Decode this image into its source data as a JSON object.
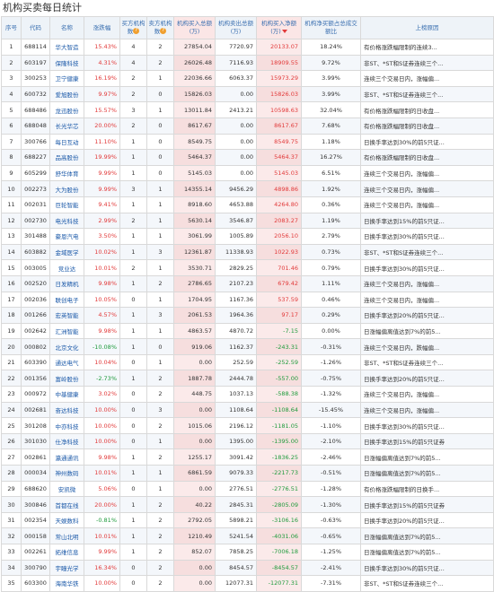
{
  "page": {
    "title": "机构买卖每日统计"
  },
  "columns": [
    {
      "key": "seq",
      "label": "序号"
    },
    {
      "key": "code",
      "label": "代码"
    },
    {
      "key": "name",
      "label": "名称"
    },
    {
      "key": "change",
      "label": "涨跌幅"
    },
    {
      "key": "buyers",
      "label": "买方机构数"
    },
    {
      "key": "sellers",
      "label": "卖方机构数"
    },
    {
      "key": "buy",
      "label": "机构买入总额(万)"
    },
    {
      "key": "sell",
      "label": "机构卖出总额(万)"
    },
    {
      "key": "net",
      "label": "机构买入净额(万)"
    },
    {
      "key": "ratio",
      "label": "机构净买额占总成交额比"
    },
    {
      "key": "reason",
      "label": "上榜原因"
    }
  ],
  "rows": [
    {
      "seq": "1",
      "code": "688114",
      "name": "华大智造",
      "change": "15.43%",
      "buyers": "4",
      "sellers": "2",
      "buy": "27854.04",
      "sell": "7720.97",
      "net": "20133.07",
      "ratio": "18.24%",
      "reason": "有价格涨跌幅限制的连续3..."
    },
    {
      "seq": "2",
      "code": "603197",
      "name": "保隆科技",
      "change": "4.31%",
      "buyers": "4",
      "sellers": "2",
      "buy": "26026.48",
      "sell": "7116.93",
      "net": "18909.55",
      "ratio": "9.72%",
      "reason": "非ST、*ST和S证券连续三个..."
    },
    {
      "seq": "3",
      "code": "300253",
      "name": "卫宁健康",
      "change": "16.19%",
      "buyers": "2",
      "sellers": "1",
      "buy": "22036.66",
      "sell": "6063.37",
      "net": "15973.29",
      "ratio": "3.99%",
      "reason": "连续三个交易日内，涨幅偏..."
    },
    {
      "seq": "4",
      "code": "600732",
      "name": "爱旭股份",
      "change": "9.97%",
      "buyers": "2",
      "sellers": "0",
      "buy": "15826.03",
      "sell": "0.00",
      "net": "15826.03",
      "ratio": "3.99%",
      "reason": "非ST、*ST和S证券连续三个..."
    },
    {
      "seq": "5",
      "code": "688486",
      "name": "龙迅股份",
      "change": "15.57%",
      "buyers": "3",
      "sellers": "1",
      "buy": "13011.84",
      "sell": "2413.21",
      "net": "10598.63",
      "ratio": "32.04%",
      "reason": "有价格涨跌幅限制的日收盘..."
    },
    {
      "seq": "6",
      "code": "688048",
      "name": "长光华芯",
      "change": "20.00%",
      "buyers": "2",
      "sellers": "0",
      "buy": "8617.67",
      "sell": "0.00",
      "net": "8617.67",
      "ratio": "7.68%",
      "reason": "有价格涨跌幅限制的日收盘..."
    },
    {
      "seq": "7",
      "code": "300766",
      "name": "每日互动",
      "change": "11.10%",
      "buyers": "1",
      "sellers": "0",
      "buy": "8549.75",
      "sell": "0.00",
      "net": "8549.75",
      "ratio": "1.18%",
      "reason": "日换手率达到30%的前5只证..."
    },
    {
      "seq": "8",
      "code": "688227",
      "name": "品高股份",
      "change": "19.99%",
      "buyers": "1",
      "sellers": "0",
      "buy": "5464.37",
      "sell": "0.00",
      "net": "5464.37",
      "ratio": "16.27%",
      "reason": "有价格涨跌幅限制的日收盘..."
    },
    {
      "seq": "9",
      "code": "605299",
      "name": "舒华体育",
      "change": "9.99%",
      "buyers": "1",
      "sellers": "0",
      "buy": "5145.03",
      "sell": "0.00",
      "net": "5145.03",
      "ratio": "6.51%",
      "reason": "连续三个交易日内，涨幅偏..."
    },
    {
      "seq": "10",
      "code": "002273",
      "name": "大为股份",
      "change": "9.99%",
      "buyers": "3",
      "sellers": "1",
      "buy": "14355.14",
      "sell": "9456.29",
      "net": "4898.86",
      "ratio": "1.92%",
      "reason": "连续三个交易日内，涨幅偏..."
    },
    {
      "seq": "11",
      "code": "002031",
      "name": "巨轮智能",
      "change": "9.41%",
      "buyers": "1",
      "sellers": "1",
      "buy": "8918.60",
      "sell": "4653.88",
      "net": "4264.80",
      "ratio": "0.36%",
      "reason": "连续三个交易日内，涨幅偏..."
    },
    {
      "seq": "12",
      "code": "002730",
      "name": "电光科技",
      "change": "2.99%",
      "buyers": "2",
      "sellers": "1",
      "buy": "5630.14",
      "sell": "3546.87",
      "net": "2083.27",
      "ratio": "1.19%",
      "reason": "日换手率达到15%的前5只证..."
    },
    {
      "seq": "13",
      "code": "301488",
      "name": "豪恩汽电",
      "change": "3.50%",
      "buyers": "1",
      "sellers": "1",
      "buy": "3061.99",
      "sell": "1005.89",
      "net": "2056.10",
      "ratio": "2.79%",
      "reason": "日换手率达到30%的前5只证..."
    },
    {
      "seq": "14",
      "code": "603882",
      "name": "金域医学",
      "change": "10.02%",
      "buyers": "1",
      "sellers": "3",
      "buy": "12361.87",
      "sell": "11338.93",
      "net": "1022.93",
      "ratio": "0.73%",
      "reason": "非ST、*ST和S证券连续三个..."
    },
    {
      "seq": "15",
      "code": "003005",
      "name": "竞业达",
      "change": "10.01%",
      "buyers": "2",
      "sellers": "1",
      "buy": "3530.71",
      "sell": "2829.25",
      "net": "701.46",
      "ratio": "0.79%",
      "reason": "日换手率达到30%的前5只证..."
    },
    {
      "seq": "16",
      "code": "002520",
      "name": "日发精机",
      "change": "9.98%",
      "buyers": "1",
      "sellers": "2",
      "buy": "2786.65",
      "sell": "2107.23",
      "net": "679.42",
      "ratio": "1.11%",
      "reason": "连续三个交易日内，涨幅偏..."
    },
    {
      "seq": "17",
      "code": "002036",
      "name": "联创电子",
      "change": "10.05%",
      "buyers": "0",
      "sellers": "1",
      "buy": "1704.95",
      "sell": "1167.36",
      "net": "537.59",
      "ratio": "0.46%",
      "reason": "连续三个交易日内，涨幅偏..."
    },
    {
      "seq": "18",
      "code": "001266",
      "name": "宏英智能",
      "change": "4.57%",
      "buyers": "1",
      "sellers": "3",
      "buy": "2061.53",
      "sell": "1964.36",
      "net": "97.17",
      "ratio": "0.29%",
      "reason": "日换手率达到20%的前5只证..."
    },
    {
      "seq": "19",
      "code": "002642",
      "name": "汇洲智能",
      "change": "9.98%",
      "buyers": "1",
      "sellers": "1",
      "buy": "4863.57",
      "sell": "4870.72",
      "net": "-7.15",
      "ratio": "0.00%",
      "reason": "日涨幅偏离值达到7%的前5..."
    },
    {
      "seq": "20",
      "code": "000802",
      "name": "北京文化",
      "change": "-10.08%",
      "buyers": "1",
      "sellers": "0",
      "buy": "919.06",
      "sell": "1162.37",
      "net": "-243.31",
      "ratio": "-0.31%",
      "reason": "连续三个交易日内，跌幅偏..."
    },
    {
      "seq": "21",
      "code": "603390",
      "name": "通达电气",
      "change": "10.04%",
      "buyers": "0",
      "sellers": "1",
      "buy": "0.00",
      "sell": "252.59",
      "net": "-252.59",
      "ratio": "-1.26%",
      "reason": "非ST、*ST和S证券连续三个..."
    },
    {
      "seq": "22",
      "code": "001356",
      "name": "富岭股份",
      "change": "-2.73%",
      "buyers": "1",
      "sellers": "2",
      "buy": "1887.78",
      "sell": "2444.78",
      "net": "-557.00",
      "ratio": "-0.75%",
      "reason": "日换手率达到20%的前5只证..."
    },
    {
      "seq": "23",
      "code": "000972",
      "name": "中基健康",
      "change": "3.02%",
      "buyers": "0",
      "sellers": "2",
      "buy": "448.75",
      "sell": "1037.13",
      "net": "-588.38",
      "ratio": "-1.32%",
      "reason": "连续三个交易日内，涨幅偏..."
    },
    {
      "seq": "24",
      "code": "002681",
      "name": "奋达科技",
      "change": "10.00%",
      "buyers": "0",
      "sellers": "3",
      "buy": "0.00",
      "sell": "1108.64",
      "net": "-1108.64",
      "ratio": "-15.45%",
      "reason": "连续三个交易日内，涨幅偏..."
    },
    {
      "seq": "25",
      "code": "301208",
      "name": "中亦科技",
      "change": "10.00%",
      "buyers": "0",
      "sellers": "2",
      "buy": "1015.06",
      "sell": "2196.12",
      "net": "-1181.05",
      "ratio": "-1.10%",
      "reason": "日换手率达到30%的前5只证..."
    },
    {
      "seq": "26",
      "code": "301030",
      "name": "仕净科技",
      "change": "10.00%",
      "buyers": "0",
      "sellers": "1",
      "buy": "0.00",
      "sell": "1395.00",
      "net": "-1395.00",
      "ratio": "-2.10%",
      "reason": "日换手率达到15%的前5只证券"
    },
    {
      "seq": "27",
      "code": "002861",
      "name": "瀛通通讯",
      "change": "9.98%",
      "buyers": "1",
      "sellers": "2",
      "buy": "1255.17",
      "sell": "3091.42",
      "net": "-1836.25",
      "ratio": "-2.46%",
      "reason": "日涨幅偏离值达到7%的前5..."
    },
    {
      "seq": "28",
      "code": "000034",
      "name": "神州数码",
      "change": "10.01%",
      "buyers": "1",
      "sellers": "1",
      "buy": "6861.59",
      "sell": "9079.33",
      "net": "-2217.73",
      "ratio": "-0.51%",
      "reason": "日涨幅偏离值达到7%的前5..."
    },
    {
      "seq": "29",
      "code": "688620",
      "name": "安凯微",
      "change": "5.06%",
      "buyers": "0",
      "sellers": "1",
      "buy": "0.00",
      "sell": "2776.51",
      "net": "-2776.51",
      "ratio": "-1.28%",
      "reason": "有价格涨跌幅限制的日换手..."
    },
    {
      "seq": "30",
      "code": "300846",
      "name": "首都在线",
      "change": "20.00%",
      "buyers": "1",
      "sellers": "2",
      "buy": "40.22",
      "sell": "2845.31",
      "net": "-2805.09",
      "ratio": "-1.30%",
      "reason": "日换手率达到15%的前5只证券"
    },
    {
      "seq": "31",
      "code": "002354",
      "name": "天娱数科",
      "change": "-0.81%",
      "buyers": "1",
      "sellers": "2",
      "buy": "2792.05",
      "sell": "5898.21",
      "net": "-3106.16",
      "ratio": "-0.63%",
      "reason": "日换手率达到20%的前5只证..."
    },
    {
      "seq": "32",
      "code": "000158",
      "name": "常山北明",
      "change": "10.01%",
      "buyers": "1",
      "sellers": "2",
      "buy": "1210.49",
      "sell": "5241.54",
      "net": "-4031.06",
      "ratio": "-0.65%",
      "reason": "日涨幅偏离值达到7%的前5..."
    },
    {
      "seq": "33",
      "code": "002261",
      "name": "拓维信息",
      "change": "9.99%",
      "buyers": "1",
      "sellers": "2",
      "buy": "852.07",
      "sell": "7858.25",
      "net": "-7006.18",
      "ratio": "-1.25%",
      "reason": "日涨幅偏离值达到7%的前5..."
    },
    {
      "seq": "34",
      "code": "300790",
      "name": "宇瞳光学",
      "change": "16.34%",
      "buyers": "0",
      "sellers": "2",
      "buy": "0.00",
      "sell": "8454.57",
      "net": "-8454.57",
      "ratio": "-2.41%",
      "reason": "日换手率达到30%的前5只证..."
    },
    {
      "seq": "35",
      "code": "603300",
      "name": "海南华铁",
      "change": "10.00%",
      "buyers": "0",
      "sellers": "2",
      "buy": "0.00",
      "sell": "12077.31",
      "net": "-12077.31",
      "ratio": "-7.31%",
      "reason": "非ST、*ST和S证券连续三个..."
    }
  ]
}
